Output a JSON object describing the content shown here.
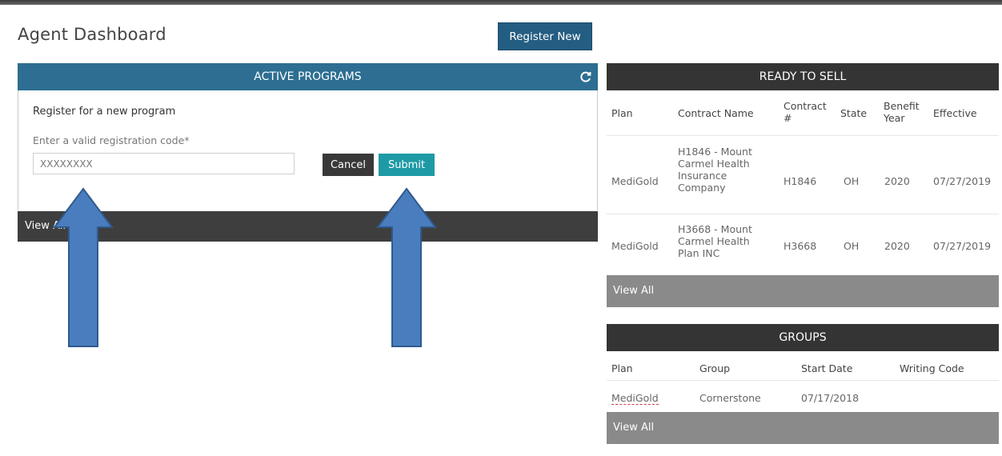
{
  "page": {
    "title": "Agent Dashboard",
    "register_button": "Register New"
  },
  "active_programs": {
    "header": "ACTIVE PROGRAMS",
    "register_label": "Register for a new program",
    "code_label": "Enter a valid registration code*",
    "code_value": "XXXXXXXX",
    "cancel_label": "Cancel",
    "submit_label": "Submit",
    "view_all": "View All"
  },
  "ready_to_sell": {
    "header": "READY TO SELL",
    "columns": [
      "Plan",
      "Contract Name",
      "Contract #",
      "State",
      "Benefit Year",
      "Effective"
    ],
    "rows": [
      {
        "plan": "MediGold",
        "contract_name": "H1846 - Mount Carmel Health Insurance Company",
        "contract_num": "H1846",
        "state": "OH",
        "benefit_year": "2020",
        "effective": "07/27/2019"
      },
      {
        "plan": "MediGold",
        "contract_name": "H3668 - Mount Carmel Health Plan INC",
        "contract_num": "H3668",
        "state": "OH",
        "benefit_year": "2020",
        "effective": "07/27/2019"
      }
    ],
    "view_all": "View All"
  },
  "groups": {
    "header": "GROUPS",
    "columns": [
      "Plan",
      "Group",
      "Start Date",
      "Writing Code"
    ],
    "rows": [
      {
        "plan": "MediGold",
        "group": "Cornerstone",
        "start_date": "07/17/2018",
        "writing_code": ""
      }
    ],
    "view_all": "View All"
  },
  "colors": {
    "header_blue": "#2d6e92",
    "submit_teal": "#1d9aa6",
    "dark_header": "#343434",
    "arrow_blue": "#4a7dbd"
  },
  "icons": {
    "refresh": "refresh-icon",
    "annotation_arrow": "up-arrow-icon"
  }
}
